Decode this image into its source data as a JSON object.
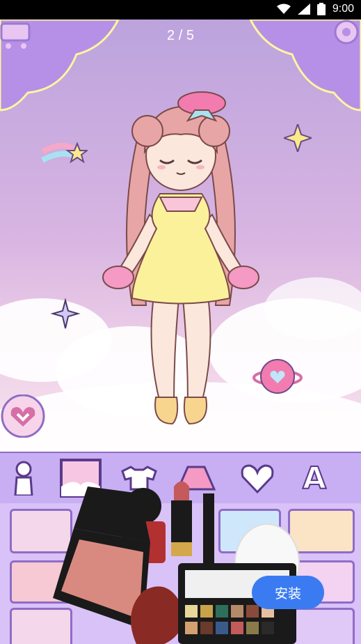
{
  "status_bar": {
    "time": "9:00"
  },
  "game": {
    "page_indicator": "2 / 5",
    "icons": [
      "shop-cart-icon",
      "gear-icon",
      "heart-down-button",
      "body-tab-icon",
      "background-tab-icon",
      "clothes-tab-icon",
      "skirt-tab-icon",
      "heart-tab-icon",
      "text-tab-icon"
    ],
    "text_tab_glyph": "A"
  },
  "ad": {
    "install_label": "安装"
  },
  "colors": {
    "install_blue": "#3b7bf2",
    "frame_purple": "#8f6cc7",
    "dress_yellow": "#fbf19b",
    "hair_pink": "#e8a5a5"
  }
}
